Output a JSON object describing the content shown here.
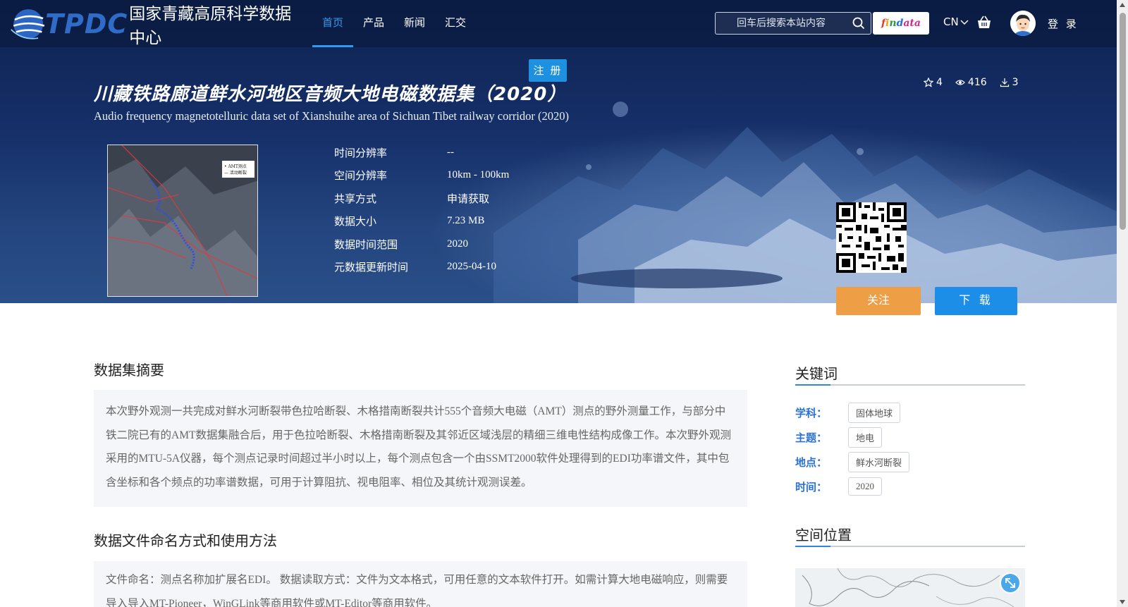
{
  "header": {
    "logo_latin": "TPDC",
    "logo_name": "国家青藏高原科学数据中心",
    "nav": [
      "首页",
      "产品",
      "新闻",
      "汇交"
    ],
    "search_placeholder": "回车后搜索本站内容",
    "findata": [
      "f",
      "i",
      "n",
      "d",
      "ata"
    ],
    "lang": "CN",
    "login": "登 录",
    "register": "注 册"
  },
  "dataset": {
    "title_cn": "川藏铁路廊道鲜水河地区音频大地电磁数据集（2020）",
    "title_en": "Audio frequency magnetotelluric data set of Xianshuihe area of Sichuan Tibet railway corridor (2020)",
    "stats": {
      "stars": "4",
      "views": "416",
      "downloads": "3"
    },
    "thumbnail_legend": [
      "• AMT测点",
      "— 活动断裂"
    ],
    "info": [
      {
        "label": "时间分辨率",
        "value": "--"
      },
      {
        "label": "空间分辨率",
        "value": "10km - 100km"
      },
      {
        "label": "共享方式",
        "value": "申请获取"
      },
      {
        "label": "数据大小",
        "value": "7.23 MB"
      },
      {
        "label": "数据时间范围",
        "value": "2020"
      },
      {
        "label": "元数据更新时间",
        "value": "2025-04-10"
      }
    ],
    "follow_label": "关注",
    "download_label": "下 载"
  },
  "summary": {
    "title": "数据集摘要",
    "text": "本次野外观测一共完成对鲜水河断裂带色拉哈断裂、木格措南断裂共计555个音频大电磁（AMT）测点的野外测量工作，与部分中铁二院已有的AMT数据集融合后，用于色拉哈断裂、木格措南断裂及其邻近区域浅层的精细三维电性结构成像工作。本次野外观测采用的MTU-5A仪器，每个测点记录时间超过半小时以上，每个测点包含一个由SSMT2000软件处理得到的EDI功率谱文件，其中包含坐标和各个频点的功率谱数据，可用于计算阻抗、视电阻率、相位及其统计观测误差。"
  },
  "naming": {
    "title": "数据文件命名方式和使用方法",
    "text": "文件命名：测点名称加扩展名EDI。 数据读取方式：文件为文本格式，可用任意的文本软件打开。如需计算大地电磁响应，则需要导入导入MT-Pioneer，WinGLink等商用软件或MT-Editor等商用软件。"
  },
  "keywords": {
    "title": "关键词",
    "rows": [
      {
        "label": "学科：",
        "tag": "固体地球"
      },
      {
        "label": "主题：",
        "tag": "地电"
      },
      {
        "label": "地点：",
        "tag": "鲜水河断裂"
      },
      {
        "label": "时间：",
        "tag": "2020"
      }
    ]
  },
  "location": {
    "title": "空间位置"
  },
  "colors": {
    "accent": "#2e9bf0",
    "follow": "#ee9e44",
    "download": "#1c8ee8",
    "keyword_label": "#2a72d6"
  }
}
